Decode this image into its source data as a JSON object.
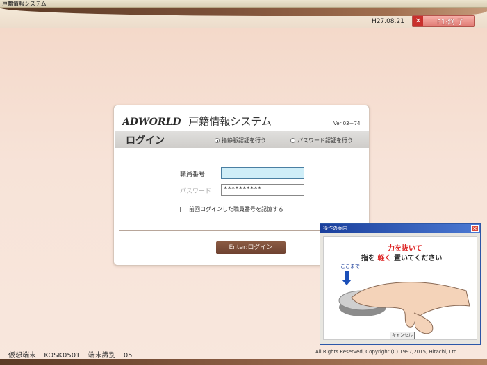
{
  "window": {
    "title": "戸籍情報システム"
  },
  "header": {
    "date": "H27.08.21",
    "exit_button": "F1:終 了",
    "exit_icon": "close-icon"
  },
  "panel": {
    "brand": "ADWORLD",
    "system_name": "戸籍情報システム",
    "version": "Ver 03－74",
    "login_title": "ログイン",
    "auth_fingerprint": "指静脈認証を行う",
    "auth_password": "パスワード認証を行う",
    "staff_number_label": "職員番号",
    "staff_number_value": "",
    "password_label": "パスワード",
    "password_value": "**********",
    "remember_label": "前回ログインした職員番号を記憶する",
    "login_button": "Enter:ログイン"
  },
  "dialog": {
    "title": "操作の案内",
    "line1": "力を抜いて",
    "line2_prefix": "指を ",
    "line2_em": "軽く",
    "line2_suffix": " 置いてください",
    "marker": "ここまで",
    "cancel": "キャンセル"
  },
  "footer": {
    "terminal_label": "仮想端末",
    "terminal_value": "KOSK0501",
    "id_label": "端末識別",
    "id_value": "05",
    "copyright": "All Rights Reserved, Copyright (C) 1997,2015, Hitachi, Ltd."
  },
  "colors": {
    "accent": "#6e4231",
    "exit": "#e07b74",
    "focus": "#cfeef8"
  }
}
